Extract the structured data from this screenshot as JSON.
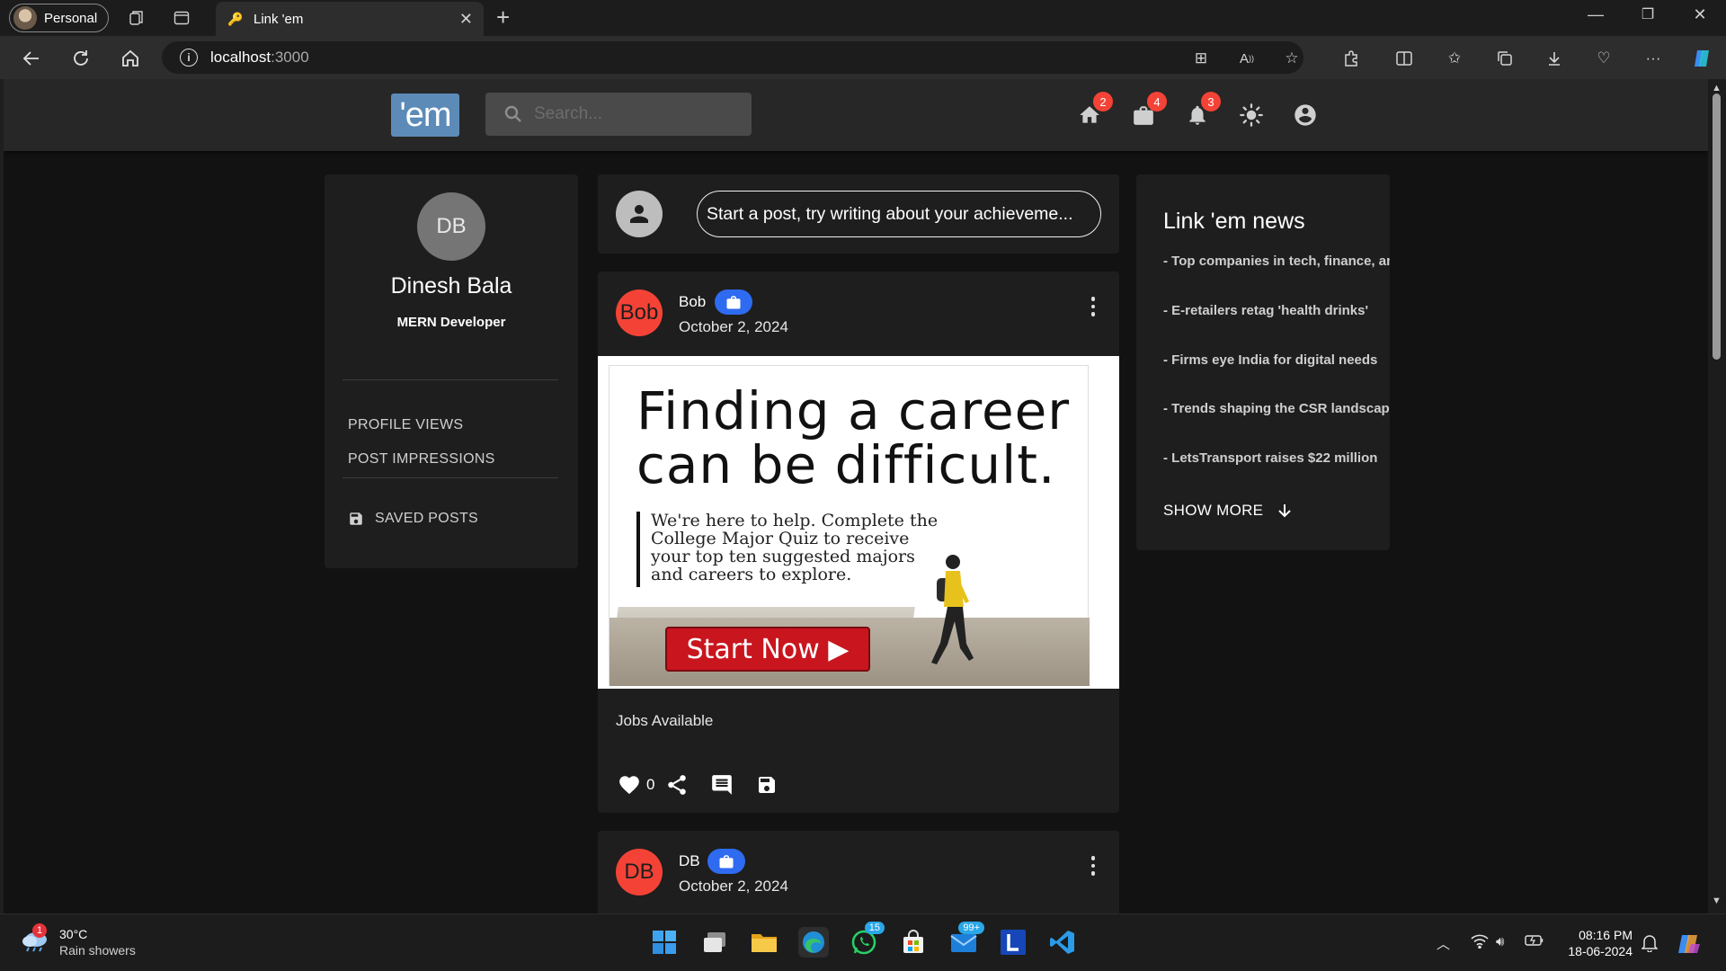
{
  "browser": {
    "profile_label": "Personal",
    "tab_title": "Link 'em",
    "url_host": "localhost",
    "url_port": ":3000",
    "win_minimize": "—",
    "win_restore": "❐",
    "win_close": "✕"
  },
  "header": {
    "logo": "'em",
    "search_placeholder": "Search...",
    "badges": {
      "home": "2",
      "jobs": "4",
      "notifications": "3"
    }
  },
  "profile": {
    "initials": "DB",
    "name": "Dinesh Bala",
    "title": "MERN Developer",
    "links": [
      "PROFILE VIEWS",
      "POST IMPRESSIONS"
    ],
    "saved_label": "SAVED POSTS"
  },
  "composer": {
    "prompt": "Start a post, try writing about your achieveme..."
  },
  "posts": [
    {
      "avatar": "Bob",
      "author": "Bob",
      "date": "October 2, 2024",
      "image": {
        "headline_1": "Finding a career",
        "headline_2": "can be difficult.",
        "body": "We're here to help. Complete the College Major Quiz to receive your top ten suggested majors and careers to explore.",
        "button": "Start Now ▶"
      },
      "text": "Jobs Available",
      "likes": "0"
    },
    {
      "avatar": "DB",
      "author": "DB",
      "date": "October 2, 2024"
    }
  ],
  "news": {
    "title": "Link 'em news",
    "items": [
      "- Top companies in tech, finance, an",
      "- E-retailers retag 'health drinks'",
      "- Firms eye India for digital needs",
      "- Trends shaping the CSR landscape",
      "- LetsTransport raises $22 million"
    ],
    "show_more": "SHOW MORE"
  },
  "taskbar": {
    "weather_alert": "1",
    "temperature": "30°C",
    "weather": "Rain showers",
    "whatsapp_badge": "15",
    "mail_badge": "99+",
    "time": "08:16 PM",
    "date": "18-06-2024"
  },
  "colors": {
    "accent_chip": "#2e6bf0",
    "avatar_red": "#f44336",
    "logo_bg": "#5c8bb8",
    "badge": "#f44336"
  }
}
